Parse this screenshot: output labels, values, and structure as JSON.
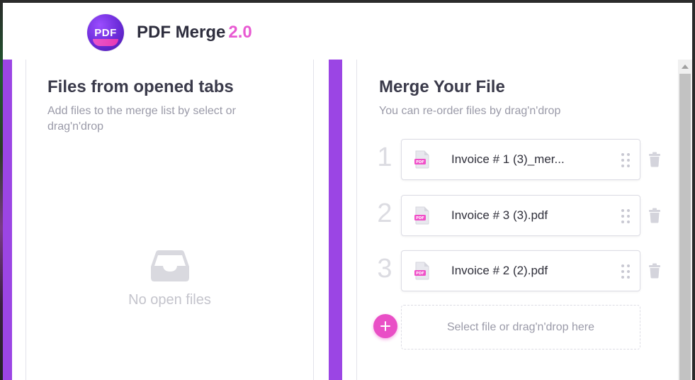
{
  "app": {
    "logo_text": "PDF",
    "title": "PDF Merge",
    "version": "2.0"
  },
  "left_panel": {
    "title": "Files from opened tabs",
    "subtitle": "Add files to the merge list by select or drag'n'drop",
    "empty_text": "No open files",
    "empty_icon": "inbox-tray-icon"
  },
  "right_panel": {
    "title": "Merge Your File",
    "subtitle": "You can re-order files by drag'n'drop",
    "files": [
      {
        "index": "1",
        "name": "Invoice # 1 (3)_mer...",
        "icon": "pdf-file-icon"
      },
      {
        "index": "2",
        "name": "Invoice # 3 (3).pdf",
        "icon": "pdf-file-icon"
      },
      {
        "index": "3",
        "name": "Invoice # 2 (2).pdf",
        "icon": "pdf-file-icon"
      }
    ],
    "drop_zone_text": "Select file or drag'n'drop here",
    "add_icon": "plus-icon"
  },
  "colors": {
    "accent_purple": "#9b45e4",
    "accent_pink": "#e94fc6",
    "version_pink": "#e85ad2"
  }
}
